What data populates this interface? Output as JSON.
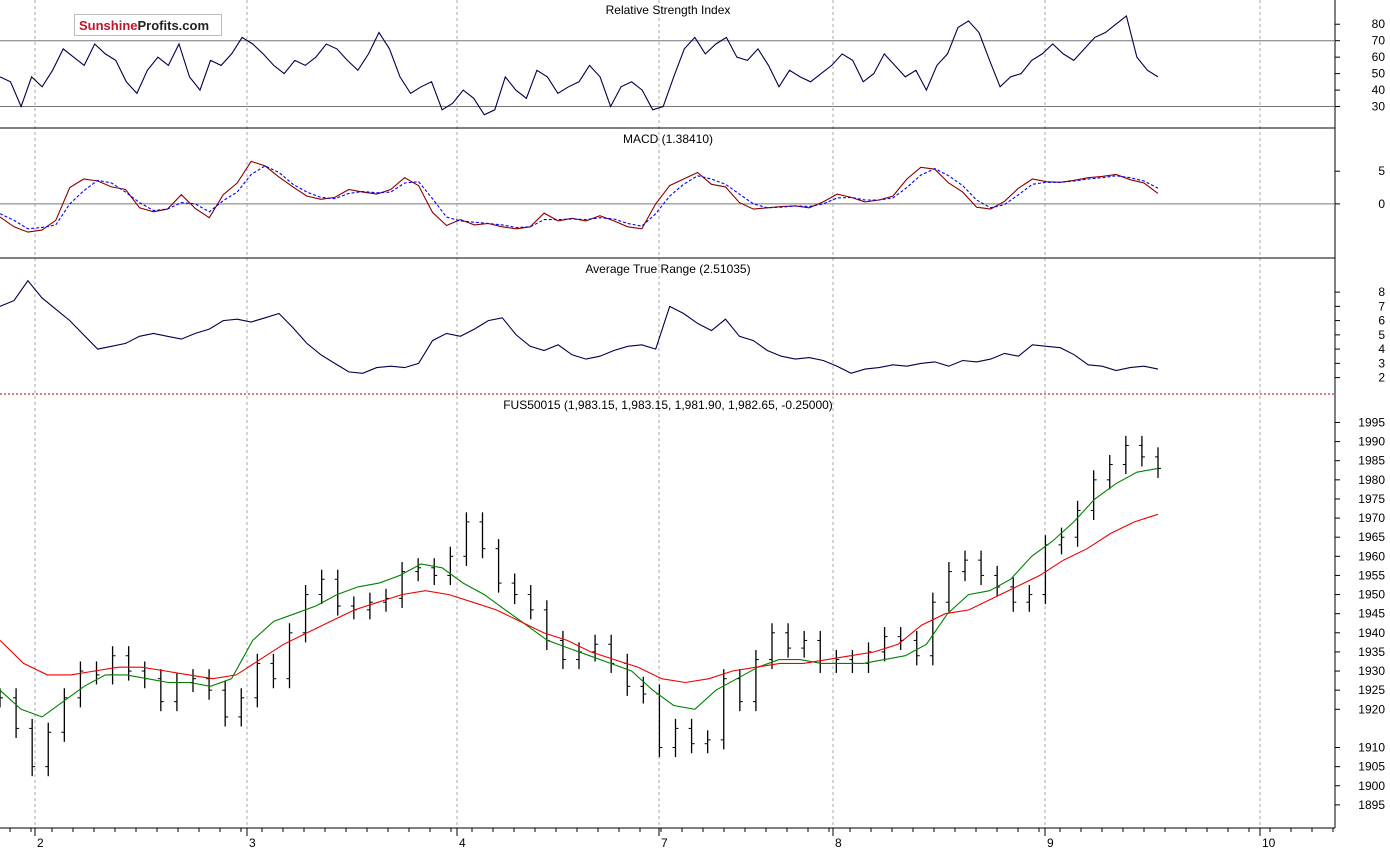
{
  "logo": {
    "part1": "Sunshine",
    "part2": "Profits.com"
  },
  "colors": {
    "rsi_line": "#00004c",
    "macd_line": "#8b0000",
    "macd_signal": "#0000ff",
    "atr_line": "#00004c",
    "price_bar": "#000000",
    "ma_short": "#008000",
    "ma_long": "#ee0000",
    "separator_dotted": "#aa0000",
    "grid": "#aaaaaa"
  },
  "x_axis": {
    "ticks": [
      "2",
      "3",
      "4",
      "7",
      "8",
      "9",
      "10"
    ]
  },
  "chart_data": [
    {
      "type": "line",
      "title": "Relative Strength Index",
      "ylim": [
        20,
        85
      ],
      "yticks": [
        "80",
        "70",
        "60",
        "50",
        "40",
        "30"
      ],
      "reference_lines": [
        70,
        30
      ],
      "series": [
        {
          "values": [
            48,
            45,
            30,
            48,
            42,
            52,
            65,
            60,
            55,
            68,
            62,
            58,
            45,
            38,
            52,
            60,
            55,
            68,
            48,
            40,
            58,
            55,
            62,
            72,
            68,
            62,
            55,
            50,
            58,
            55,
            60,
            68,
            65,
            58,
            52,
            62,
            75,
            65,
            48,
            38,
            42,
            45,
            28,
            32,
            40,
            35,
            25,
            28,
            48,
            40,
            35,
            52,
            48,
            38,
            42,
            45,
            55,
            48,
            30,
            42,
            45,
            40,
            28,
            30,
            48,
            65,
            72,
            62,
            68,
            72,
            60,
            58,
            65,
            55,
            42,
            52,
            48,
            45,
            50,
            55,
            62,
            58,
            45,
            50,
            62,
            55,
            48,
            52,
            40,
            55,
            62,
            78,
            82,
            75,
            58,
            42,
            48,
            50,
            58,
            62,
            68,
            62,
            58,
            65,
            72,
            75,
            80,
            85,
            60,
            52,
            48
          ]
        }
      ]
    },
    {
      "type": "line",
      "title": "MACD (1.38410)",
      "ylim": [
        -7.5,
        9
      ],
      "yticks": [
        "5",
        "0"
      ],
      "reference_lines": [
        0
      ],
      "series": [
        {
          "values": [
            -2.0,
            -3.5,
            -4.3,
            -4.0,
            -2.5,
            2.5,
            3.8,
            3.5,
            2.6,
            2.2,
            -0.6,
            -1.2,
            -0.8,
            1.4,
            -0.7,
            -2.1,
            1.4,
            3.2,
            6.5,
            5.8,
            4.1,
            2.6,
            1.2,
            0.7,
            1.0,
            2.2,
            1.8,
            1.5,
            2.2,
            4.0,
            2.8,
            -1.3,
            -3.3,
            -2.4,
            -3.2,
            -3.0,
            -3.5,
            -3.8,
            -3.5,
            -1.4,
            -2.6,
            -2.2,
            -2.6,
            -1.8,
            -2.6,
            -3.5,
            -3.8,
            0.0,
            2.8,
            3.8,
            4.8,
            3.0,
            2.6,
            0.2,
            -0.8,
            -0.6,
            -0.4,
            -0.3,
            -0.6,
            0.3,
            1.5,
            1.0,
            0.3,
            0.6,
            1.2,
            3.8,
            5.6,
            5.3,
            3.2,
            1.8,
            -0.5,
            -0.8,
            0.4,
            2.4,
            3.8,
            3.4,
            3.3,
            3.6,
            4.0,
            4.2,
            4.5,
            3.7,
            3.2,
            1.6
          ]
        },
        {
          "values": [
            -1.5,
            -2.5,
            -3.8,
            -3.6,
            -3.2,
            0.0,
            2.0,
            3.6,
            3.2,
            1.8,
            0.2,
            -1.0,
            -0.8,
            0.2,
            0.0,
            -1.2,
            0.5,
            1.8,
            4.5,
            5.8,
            4.8,
            3.0,
            1.8,
            1.0,
            0.8,
            1.6,
            1.9,
            1.7,
            1.8,
            3.2,
            3.4,
            0.8,
            -2.0,
            -2.6,
            -2.8,
            -3.0,
            -3.2,
            -3.6,
            -3.5,
            -2.4,
            -2.4,
            -2.3,
            -2.4,
            -2.1,
            -2.3,
            -3.0,
            -3.4,
            -1.5,
            1.2,
            3.0,
            4.3,
            3.8,
            3.0,
            1.5,
            0.0,
            -0.6,
            -0.5,
            -0.3,
            -0.4,
            0.0,
            0.9,
            1.0,
            0.6,
            0.6,
            0.9,
            2.5,
            4.4,
            5.4,
            4.3,
            2.8,
            0.6,
            -0.6,
            -0.1,
            1.4,
            3.0,
            3.3,
            3.3,
            3.5,
            3.8,
            4.0,
            4.3,
            4.0,
            3.5,
            2.4
          ]
        }
      ]
    },
    {
      "type": "line",
      "title": "Average True Range (2.51035)",
      "ylim": [
        1.2,
        9.2
      ],
      "yticks": [
        "8",
        "7",
        "6",
        "5",
        "4",
        "3",
        "2"
      ],
      "series": [
        {
          "values": [
            7.0,
            7.4,
            8.8,
            7.6,
            6.8,
            6.0,
            5.0,
            4.0,
            4.2,
            4.4,
            4.9,
            5.1,
            4.9,
            4.7,
            5.1,
            5.4,
            6.0,
            6.1,
            5.9,
            6.2,
            6.5,
            5.5,
            4.4,
            3.6,
            3.0,
            2.4,
            2.3,
            2.7,
            2.8,
            2.7,
            3.0,
            4.6,
            5.1,
            4.9,
            5.4,
            6.0,
            6.2,
            5.0,
            4.2,
            3.9,
            4.3,
            3.6,
            3.3,
            3.5,
            3.9,
            4.2,
            4.3,
            4.0,
            7.0,
            6.5,
            5.8,
            5.3,
            6.1,
            4.9,
            4.6,
            3.9,
            3.5,
            3.3,
            3.4,
            3.2,
            2.8,
            2.3,
            2.6,
            2.7,
            2.9,
            2.8,
            3.0,
            3.1,
            2.8,
            3.2,
            3.1,
            3.3,
            3.7,
            3.5,
            4.3,
            4.2,
            4.1,
            3.6,
            2.9,
            2.8,
            2.5,
            2.7,
            2.8,
            2.6
          ]
        }
      ]
    },
    {
      "type": "line",
      "title": "FUS50015 (1,983.15, 1,983.15, 1,981.90, 1,982.65, -0.25000)",
      "ylim": [
        1890,
        1998
      ],
      "yticks": [
        "1995",
        "1990",
        "1985",
        "1980",
        "1975",
        "1970",
        "1965",
        "1960",
        "1955",
        "1950",
        "1945",
        "1940",
        "1935",
        "1930",
        "1925",
        "1920",
        "1910",
        "1905",
        "1900",
        "1895"
      ],
      "price_close": [
        1923,
        1915,
        1905,
        1914,
        1923,
        1930,
        1929,
        1934,
        1930,
        1928,
        1922,
        1927,
        1928,
        1925,
        1918,
        1923,
        1932,
        1928,
        1940,
        1950,
        1954,
        1947,
        1946,
        1948,
        1949,
        1956,
        1957,
        1955,
        1960,
        1969,
        1962,
        1953,
        1950,
        1946,
        1938,
        1933,
        1935,
        1937,
        1932,
        1926,
        1924,
        1910,
        1915,
        1911,
        1912,
        1928,
        1922,
        1933,
        1940,
        1936,
        1938,
        1932,
        1933,
        1932,
        1935,
        1939,
        1938,
        1934,
        1948,
        1956,
        1959,
        1955,
        1952,
        1948,
        1950,
        1963,
        1965,
        1972,
        1980,
        1984,
        1989,
        1986,
        1983
      ],
      "series": [
        {
          "values": [
            1925,
            1920,
            1918,
            1922,
            1926,
            1929,
            1929,
            1928,
            1927,
            1927,
            1926,
            1928,
            1938,
            1943,
            1945,
            1947,
            1950,
            1952,
            1953,
            1955,
            1958,
            1957,
            1953,
            1950,
            1946,
            1942,
            1938,
            1936,
            1934,
            1932,
            1930,
            1925,
            1921,
            1920,
            1925,
            1928,
            1931,
            1933,
            1933,
            1932,
            1932,
            1932,
            1933,
            1934,
            1937,
            1945,
            1950,
            1951,
            1954,
            1960,
            1964,
            1969,
            1975,
            1979,
            1982,
            1983
          ]
        },
        {
          "values": [
            1938,
            1932,
            1929,
            1929,
            1930,
            1931,
            1931,
            1930,
            1929,
            1928,
            1929,
            1933,
            1937,
            1940,
            1943,
            1946,
            1948,
            1950,
            1951,
            1950,
            1948,
            1946,
            1943,
            1940,
            1938,
            1935,
            1933,
            1931,
            1928,
            1927,
            1928,
            1930,
            1931,
            1932,
            1932,
            1933,
            1934,
            1935,
            1937,
            1942,
            1945,
            1946,
            1949,
            1952,
            1955,
            1959,
            1962,
            1966,
            1969,
            1971
          ]
        }
      ]
    }
  ]
}
